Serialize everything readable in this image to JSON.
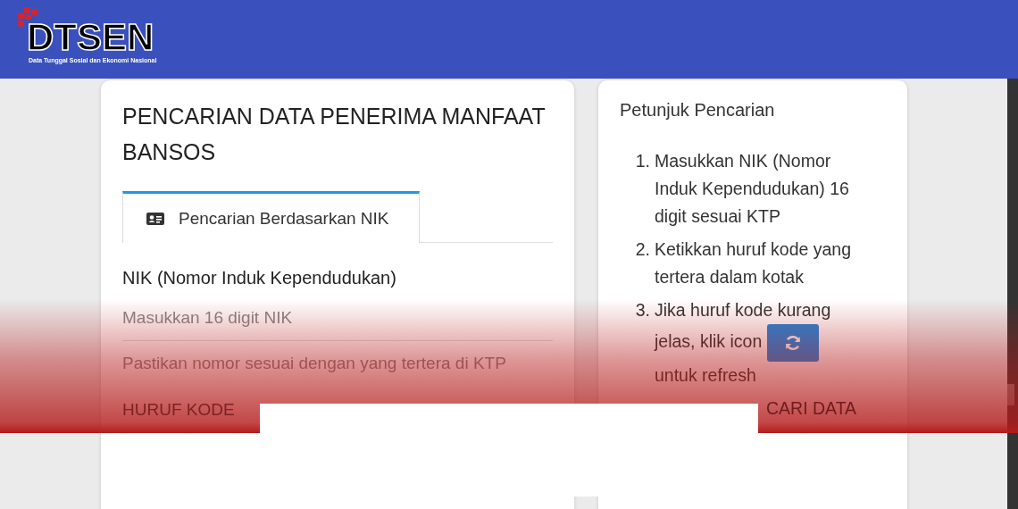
{
  "header": {
    "logo": {
      "name": "DTSEN",
      "tagline": "Data Tunggal Sosial dan Ekonomi Nasional"
    }
  },
  "search_card": {
    "title": "PENCARIAN DATA PENERIMA MANFAAT BANSOS",
    "tabs": [
      {
        "label": "Pencarian Berdasarkan NIK",
        "selected": true
      }
    ],
    "nik_field": {
      "label": "NIK (Nomor Induk Kependudukan)",
      "placeholder": "Masukkan 16 digit NIK",
      "hint": "Pastikan nomor sesuai dengan yang tertera di KTP"
    },
    "code_label": "HURUF KODE"
  },
  "guide_card": {
    "title": "Petunjuk Pencarian",
    "steps": [
      {
        "number": "1.",
        "kind": "text",
        "text": "Masukkan NIK (Nomor Induk Kependudukan) 16 digit sesuai KTP"
      },
      {
        "number": "2.",
        "kind": "text",
        "text": "Ketikkan huruf kode yang tertera dalam kotak"
      },
      {
        "number": "3.",
        "kind": "refresh",
        "text": "Jika huruf kode kurang",
        "text_cont": "jelas, klik icon",
        "text_after": "untuk refresh"
      },
      {
        "kind": "partial",
        "text": "CARI DATA"
      }
    ]
  }
}
